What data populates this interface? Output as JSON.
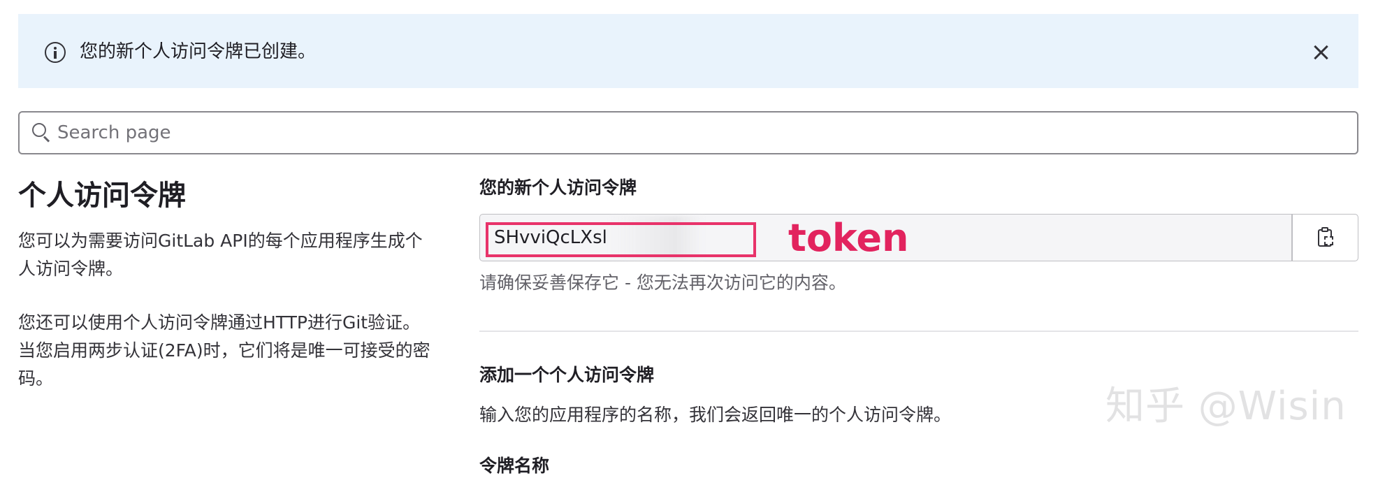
{
  "alert": {
    "message": "您的新个人访问令牌已创建。",
    "icon": "info-circle-icon",
    "close_icon": "close-icon"
  },
  "search": {
    "placeholder": "Search page",
    "value": ""
  },
  "left": {
    "title": "个人访问令牌",
    "paragraph1": "您可以为需要访问GitLab API的每个应用程序生成个人访问令牌。",
    "paragraph2": "您还可以使用个人访问令牌通过HTTP进行Git验证。 当您启用两步认证(2FA)时，它们将是唯一可接受的密码。"
  },
  "new_token": {
    "label": "您的新个人访问令牌",
    "value": "SHvviQcLXsl",
    "help": "请确保妥善保存它 - 您无法再次访问它的内容。",
    "copy_icon": "copy-to-clipboard-icon",
    "annotation": "token"
  },
  "add_token": {
    "label": "添加一个个人访问令牌",
    "description": "输入您的应用程序的名称，我们会返回唯一的个人访问令牌。",
    "name_label": "令牌名称"
  },
  "watermark": "知乎 @Wisin",
  "colors": {
    "alert_bg": "#e9f3fc",
    "annotation": "#e2235e",
    "field_bg": "#f5f5f7"
  }
}
